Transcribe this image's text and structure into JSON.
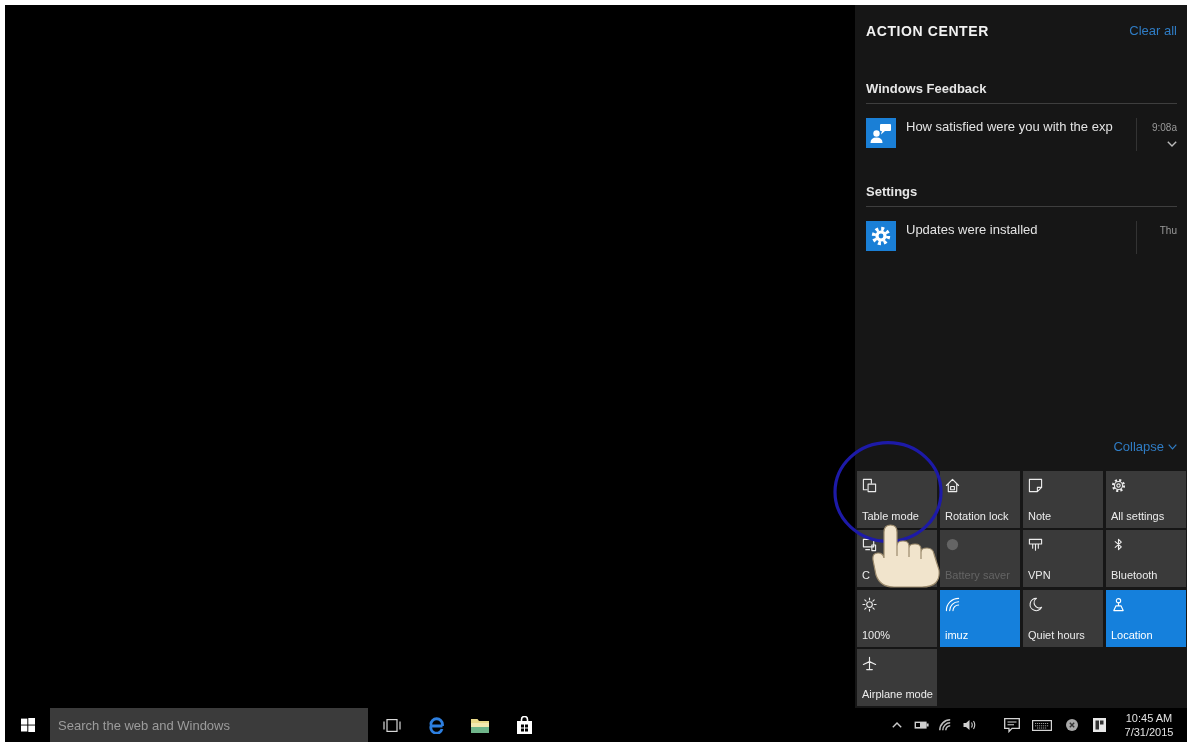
{
  "action_center": {
    "title": "ACTION CENTER",
    "clear_all": "Clear all",
    "groups": [
      {
        "app": "Windows Feedback",
        "notifications": [
          {
            "kind": "feedback",
            "text": "How satisfied were you with the exp",
            "time": "9:08a",
            "expandable": true
          }
        ]
      },
      {
        "app": "Settings",
        "notifications": [
          {
            "kind": "settings",
            "text": "Updates were installed",
            "time": "Thu",
            "expandable": false
          }
        ]
      }
    ],
    "collapse": "Collapse",
    "quick_actions": [
      {
        "kind": "tablet",
        "label": "Table mode",
        "on": false,
        "disabled": false
      },
      {
        "kind": "rotation",
        "label": "Rotation lock",
        "on": false,
        "disabled": false
      },
      {
        "kind": "note",
        "label": "Note",
        "on": false,
        "disabled": false
      },
      {
        "kind": "settings",
        "label": "All settings",
        "on": false,
        "disabled": false
      },
      {
        "kind": "connect",
        "label": "C",
        "on": false,
        "disabled": false
      },
      {
        "kind": "battery",
        "label": "Battery saver",
        "on": false,
        "disabled": true
      },
      {
        "kind": "vpn",
        "label": "VPN",
        "on": false,
        "disabled": false
      },
      {
        "kind": "bluetooth",
        "label": "Bluetooth",
        "on": false,
        "disabled": false
      },
      {
        "kind": "brightness",
        "label": "100%",
        "on": false,
        "disabled": false
      },
      {
        "kind": "wifi",
        "label": "imuz",
        "on": true,
        "disabled": false
      },
      {
        "kind": "moon",
        "label": "Quiet hours",
        "on": false,
        "disabled": false
      },
      {
        "kind": "location",
        "label": "Location",
        "on": true,
        "disabled": false
      },
      {
        "kind": "airplane",
        "label": "Airplane mode",
        "on": false,
        "disabled": false
      }
    ]
  },
  "taskbar": {
    "search": {
      "placeholder": "Search the web and Windows"
    },
    "clock": {
      "time": "10:45 AM",
      "date": "7/31/2015"
    }
  }
}
